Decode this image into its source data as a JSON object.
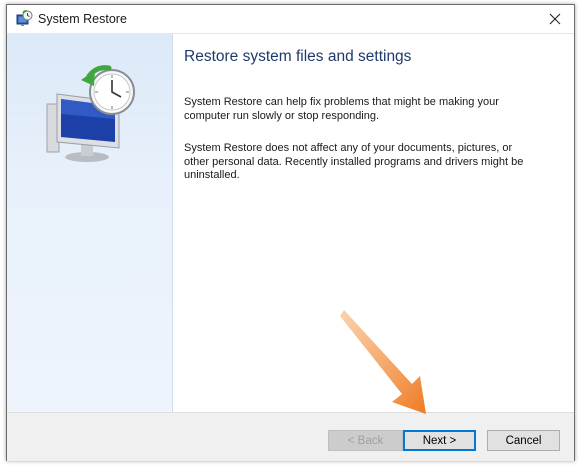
{
  "window": {
    "title": "System Restore",
    "close_glyph": "✕"
  },
  "content": {
    "heading": "Restore system files and settings",
    "paragraph1": "System Restore can help fix problems that might be making your computer run slowly or stop responding.",
    "paragraph2": "System Restore does not affect any of your documents, pictures, or other personal data. Recently installed programs and drivers might be uninstalled."
  },
  "buttons": {
    "back": "< Back",
    "next": "Next >",
    "cancel": "Cancel"
  },
  "icons": {
    "title": "system-restore-icon",
    "hero": "system-restore-clock-monitor-icon",
    "close": "close-icon",
    "annotation": "orange-pointer-arrow"
  },
  "colors": {
    "heading": "#1e3a6b",
    "sidebar": "#e2edf9",
    "accent": "#0078d7",
    "arrow": "#f0802a"
  }
}
